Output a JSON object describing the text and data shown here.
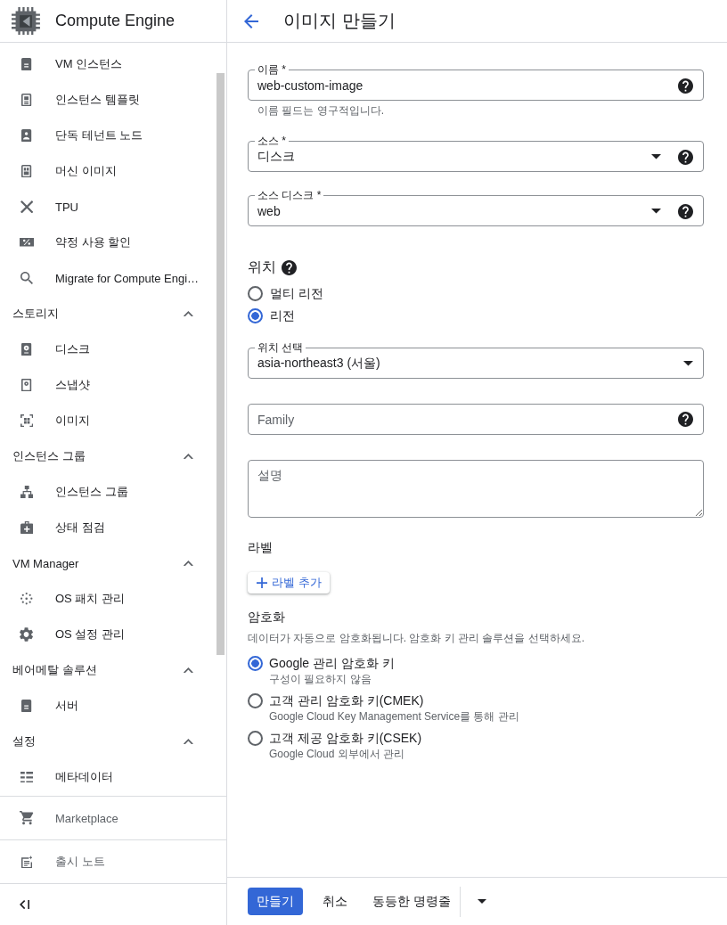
{
  "sidebar": {
    "title": "Compute Engine",
    "sections": [
      {
        "items": [
          {
            "label": "VM 인스턴스"
          },
          {
            "label": "인스턴스 템플릿"
          },
          {
            "label": "단독 테넌트 노드"
          },
          {
            "label": "머신 이미지"
          },
          {
            "label": "TPU"
          },
          {
            "label": "약정 사용 할인"
          },
          {
            "label": "Migrate for Compute Engi…"
          }
        ]
      },
      {
        "heading": "스토리지",
        "expanded": true,
        "items": [
          {
            "label": "디스크"
          },
          {
            "label": "스냅샷"
          },
          {
            "label": "이미지"
          }
        ]
      },
      {
        "heading": "인스턴스 그룹",
        "expanded": true,
        "items": [
          {
            "label": "인스턴스 그룹"
          },
          {
            "label": "상태 점검"
          }
        ]
      },
      {
        "heading": "VM Manager",
        "expanded": true,
        "items": [
          {
            "label": "OS 패치 관리"
          },
          {
            "label": "OS 설정 관리"
          }
        ]
      },
      {
        "heading": "베어메탈 솔루션",
        "expanded": true,
        "items": [
          {
            "label": "서버"
          }
        ]
      },
      {
        "heading": "설정",
        "expanded": true,
        "items": [
          {
            "label": "메타데이터"
          }
        ]
      }
    ],
    "footer_links": [
      {
        "label": "Marketplace"
      },
      {
        "label": "출시 노트"
      }
    ]
  },
  "page": {
    "title": "이미지 만들기"
  },
  "form": {
    "fields": [
      {
        "kind": "text",
        "label": "이름 *",
        "value": "web-custom-image",
        "help": true,
        "helper": "이름 필드는 영구적입니다."
      },
      {
        "kind": "select",
        "label": "소스 *",
        "value": "디스크",
        "help": true
      },
      {
        "kind": "select",
        "label": "소스 디스크 *",
        "value": "web",
        "help": true
      }
    ],
    "location": {
      "heading": "위치",
      "help": true,
      "options": [
        {
          "label": "멀티 리전",
          "selected": false
        },
        {
          "label": "리전",
          "selected": true
        }
      ]
    },
    "more_fields": [
      {
        "kind": "select",
        "label": "위치 선택",
        "value": "asia-northeast3 (서울)",
        "help": false
      },
      {
        "kind": "text",
        "placeholder": "Family",
        "help": true
      },
      {
        "kind": "textarea",
        "placeholder": "설명"
      }
    ],
    "labels": {
      "heading": "라벨",
      "add_button": "라벨 추가"
    },
    "encryption": {
      "heading": "암호화",
      "description": "데이터가 자동으로 암호화됩니다. 암호화 키 관리 솔루션을 선택하세요.",
      "options": [
        {
          "label": "Google 관리 암호화 키",
          "detail": "구성이 필요하지 않음",
          "selected": true
        },
        {
          "label": "고객 관리 암호화 키(CMEK)",
          "detail": "Google Cloud Key Management Service를 통해 관리",
          "selected": false
        },
        {
          "label": "고객 제공 암호화 키(CSEK)",
          "detail": "Google Cloud 외부에서 관리",
          "selected": false
        }
      ]
    }
  },
  "actions": {
    "create": "만들기",
    "cancel": "취소",
    "command_line": "동등한 명령줄"
  }
}
